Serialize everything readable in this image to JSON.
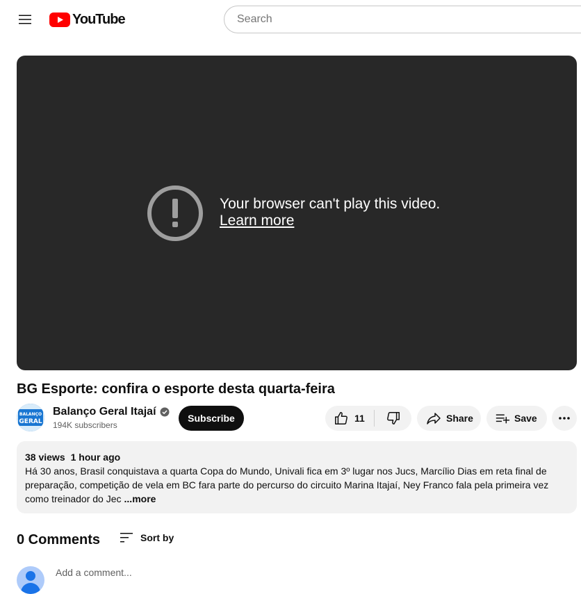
{
  "header": {
    "logo_text": "YouTube",
    "search_placeholder": "Search"
  },
  "player": {
    "error_message": "Your browser can't play this video.",
    "learn_more": "Learn more"
  },
  "video": {
    "title": "BG Esporte: confira o esporte desta quarta-feira"
  },
  "channel": {
    "name": "Balanço Geral Itajaí",
    "subscribers": "194K subscribers",
    "avatar_text_top": "BALANÇO",
    "avatar_text_bottom": "GERAL",
    "subscribe_label": "Subscribe"
  },
  "actions": {
    "like_count": "11",
    "share_label": "Share",
    "save_label": "Save"
  },
  "description": {
    "views": "38 views",
    "posted": "1 hour ago",
    "text": "Há 30 anos, Brasil conquistava a quarta Copa do Mundo, Univali fica em 3º lugar nos Jucs,  Marcílio Dias em reta final de preparação, competição de vela em BC fara parte do percurso do circuito Marina Itajaí, Ney Franco fala pela primeira vez como treinador do Jec",
    "more_label": "...more"
  },
  "comments": {
    "count": "0 Comments",
    "sort_label": "Sort by",
    "add_placeholder": "Add a comment..."
  },
  "colors": {
    "brand_red": "#ff0000",
    "player_bg": "#282828",
    "pill_bg": "#f2f2f2"
  }
}
